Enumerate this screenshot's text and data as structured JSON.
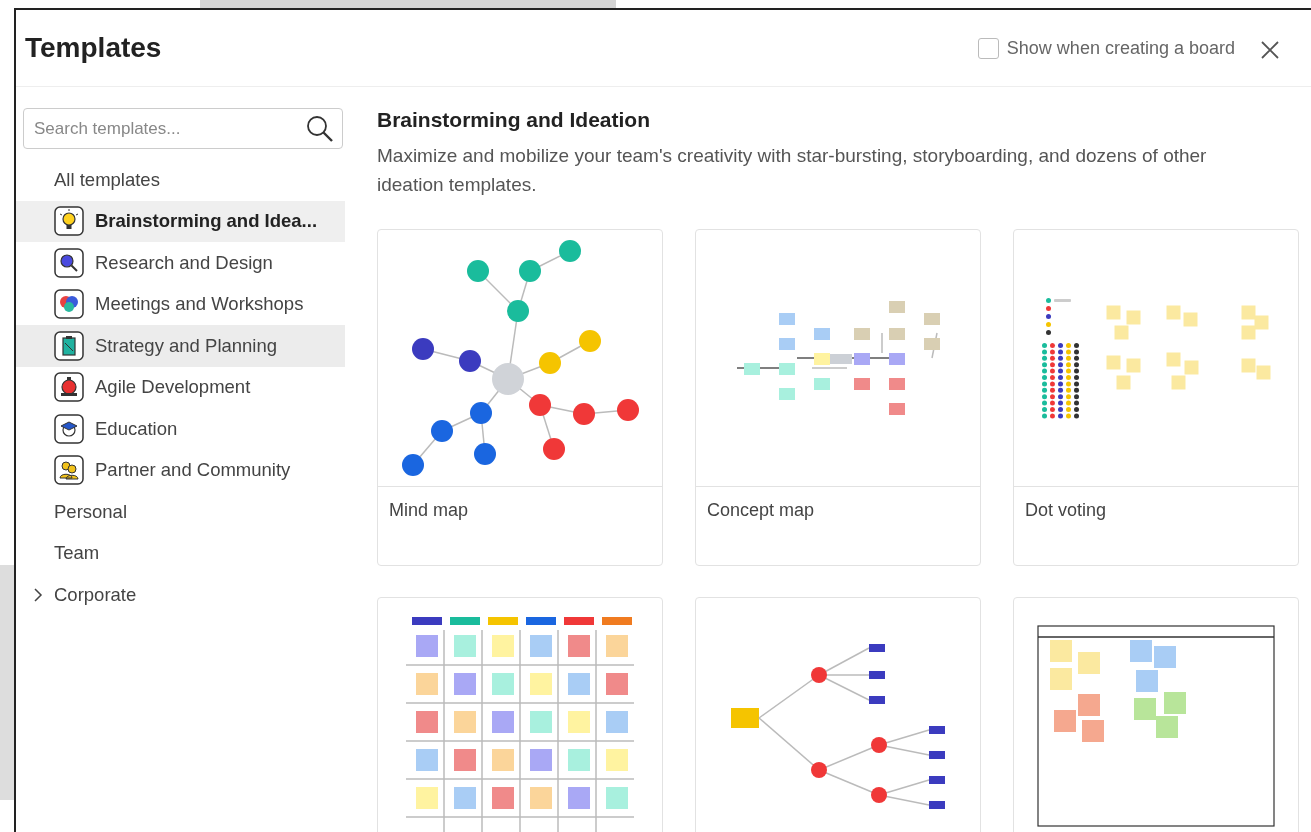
{
  "window": {
    "title": "Templates"
  },
  "show_option": {
    "label": "Show when creating a board",
    "checked": false
  },
  "search": {
    "placeholder": "Search templates..."
  },
  "sidebar": {
    "items": [
      {
        "label": "All templates",
        "kind": "plain",
        "selected": false,
        "hovered": false
      },
      {
        "label": "Brainstorming and Idea...",
        "kind": "category",
        "selected": true,
        "hovered": false
      },
      {
        "label": "Research and Design",
        "kind": "category",
        "selected": false,
        "hovered": false
      },
      {
        "label": "Meetings and Workshops",
        "kind": "category",
        "selected": false,
        "hovered": false
      },
      {
        "label": "Strategy and Planning",
        "kind": "category",
        "selected": false,
        "hovered": true
      },
      {
        "label": "Agile Development",
        "kind": "category",
        "selected": false,
        "hovered": false
      },
      {
        "label": "Education",
        "kind": "category",
        "selected": false,
        "hovered": false
      },
      {
        "label": "Partner and Community",
        "kind": "category",
        "selected": false,
        "hovered": false
      },
      {
        "label": "Personal",
        "kind": "plain",
        "selected": false,
        "hovered": false
      },
      {
        "label": "Team",
        "kind": "plain",
        "selected": false,
        "hovered": false
      },
      {
        "label": "Corporate",
        "kind": "group",
        "expanded": false,
        "selected": false,
        "hovered": false
      }
    ]
  },
  "section": {
    "title": "Brainstorming and Ideation",
    "description": "Maximize and mobilize your team's creativity with star-bursting, storyboarding, and dozens of other ideation templates."
  },
  "templates": [
    {
      "title": "Mind map",
      "kind": "mindmap"
    },
    {
      "title": "Concept map",
      "kind": "conceptmap"
    },
    {
      "title": "Dot voting",
      "kind": "dotvoting"
    },
    {
      "kind": "ideagrid"
    },
    {
      "kind": "tree"
    },
    {
      "kind": "stickies"
    }
  ]
}
